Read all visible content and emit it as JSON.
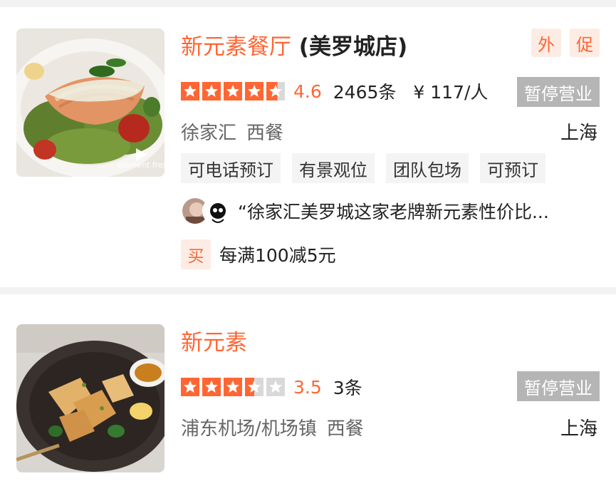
{
  "restaurants": [
    {
      "brand_name": "新元素餐厅",
      "branch_name": " (美罗城店)",
      "promo_tags": [
        "外",
        "促"
      ],
      "rating": 4.6,
      "score_text": "4.6",
      "review_count": "2465条",
      "price": "¥ 117/人",
      "status": "暂停营业",
      "area": "徐家汇",
      "cuisine": "西餐",
      "city": "上海",
      "tags": [
        "可电话预订",
        "有景观位",
        "团队包场",
        "可预订"
      ],
      "review_quote": "“徐家汇美罗城这家老牌新元素性价比...",
      "deal_badge": "买",
      "deal_text": "每满100减5元",
      "thumb_watermark": "element fres"
    },
    {
      "brand_name": "新元素",
      "rating": 3.5,
      "score_text": "3.5",
      "review_count": "3条",
      "status": "暂停营业",
      "area": "浦东机场/机场镇",
      "cuisine": "西餐",
      "city": "上海"
    }
  ],
  "colors": {
    "accent": "#ff6633",
    "tag_bg": "#fdece4",
    "closed_bg": "#b5b5b5",
    "star_empty": "#d9d9d9"
  }
}
